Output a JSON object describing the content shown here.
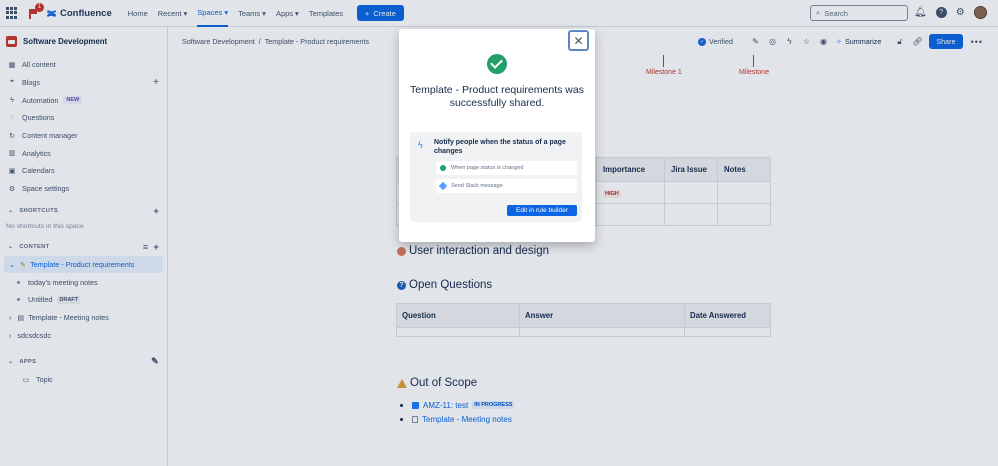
{
  "topnav": {
    "notification_count": "1",
    "app_name": "Confluence",
    "items": [
      {
        "label": "Home",
        "dropdown": false
      },
      {
        "label": "Recent",
        "dropdown": true
      },
      {
        "label": "Spaces",
        "dropdown": true,
        "active": true
      },
      {
        "label": "Teams",
        "dropdown": true
      },
      {
        "label": "Apps",
        "dropdown": true
      },
      {
        "label": "Templates",
        "dropdown": false
      }
    ],
    "create_label": "Create",
    "search_placeholder": "Search"
  },
  "sidebar": {
    "space_name": "Software Development",
    "items": [
      {
        "label": "All content",
        "icon": "grid-icon"
      },
      {
        "label": "Blogs",
        "icon": "quote-icon"
      },
      {
        "label": "Automation",
        "icon": "lightning-icon",
        "badge": "NEW"
      },
      {
        "label": "Questions",
        "icon": "chat-icon"
      },
      {
        "label": "Content manager",
        "icon": "refresh-icon"
      },
      {
        "label": "Analytics",
        "icon": "chart-icon"
      },
      {
        "label": "Calendars",
        "icon": "calendar-icon"
      },
      {
        "label": "Space settings",
        "icon": "gear-icon"
      }
    ],
    "shortcuts_heading": "SHORTCUTS",
    "shortcuts_empty": "No shortcuts in this space",
    "content_heading": "CONTENT",
    "tree": [
      {
        "label": "Template - Product requirements",
        "selected": true
      },
      {
        "label": "today's meeting notes"
      },
      {
        "label": "Untitled",
        "badge": "DRAFT"
      },
      {
        "label": "Template - Meeting notes"
      },
      {
        "label": "sdcsdcsdc"
      }
    ],
    "apps_heading": "APPS",
    "apps": [
      {
        "label": "Topic"
      }
    ]
  },
  "page": {
    "breadcrumb": [
      "Software Development",
      "Template - Product requirements"
    ],
    "breadcrumb_sep": "/",
    "verified_label": "Verified",
    "summarize_label": "Summarize",
    "share_label": "Share",
    "milestones": [
      "Milestone 1",
      "Milestone"
    ],
    "req_table": {
      "headers": [
        "Importance",
        "Jira Issue",
        "Notes"
      ],
      "rows": [
        [
          "HIGH",
          "",
          ""
        ],
        [
          "",
          "",
          ""
        ]
      ]
    },
    "heading_ui": "User interaction and design",
    "heading_questions": "Open Questions",
    "questions_table": {
      "headers": [
        "Question",
        "Answer",
        "Date Answered"
      ]
    },
    "heading_scope": "Out of Scope",
    "scope_items": [
      {
        "label": "AMZ-11: test",
        "status": "IN PROGRESS",
        "icon": "jira-icon"
      },
      {
        "label": "Template - Meeting notes",
        "icon": "page-icon"
      }
    ]
  },
  "modal": {
    "title": "Template - Product requirements was successfully shared.",
    "rule_title": "Notify people when the status of a page changes",
    "step1": "When page status is changed",
    "step2": "Send Slack message",
    "button": "Edit in rule builder"
  }
}
